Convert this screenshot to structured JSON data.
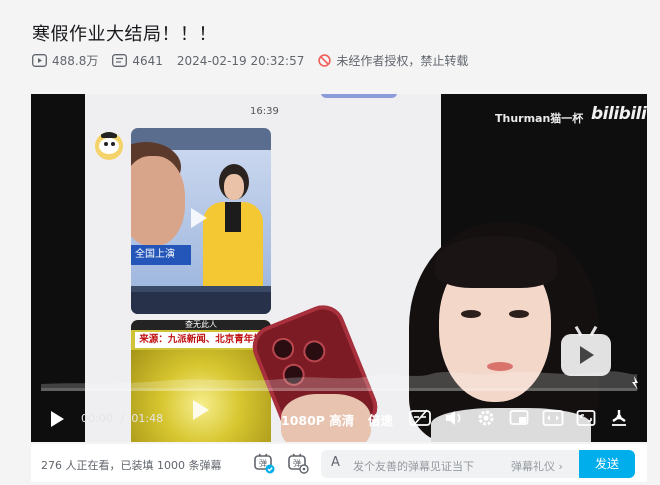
{
  "video": {
    "title": "寒假作业大结局！！！",
    "views": "488.8万",
    "danmaku_count": "4641",
    "datetime": "2024-02-19 20:32:57",
    "copyright_notice": "未经作者授权，禁止转载"
  },
  "player": {
    "chat_time": "16:39",
    "thumb1_caption": "全国上演",
    "thumb2_band": "查无此人",
    "thumb2_source": "来源：九派新闻、北京青年报",
    "watermark": "Thurman猫一杯",
    "logo_text": "bilibili",
    "current_time": "00:00",
    "time_separator": "/",
    "duration": "01:48",
    "quality": "1080P 高清",
    "speed": "倍速",
    "progress_fraction": 0
  },
  "bottombar": {
    "viewers_text": "276 人正在看，已装填 1000 条弹幕",
    "input_icon": "A",
    "input_placeholder": "发个友善的弹幕见证当下",
    "etiquette": "弹幕礼仪",
    "send_label": "发送"
  },
  "colors": {
    "accent": "#00aeec",
    "forbidden": "#f25d59"
  }
}
